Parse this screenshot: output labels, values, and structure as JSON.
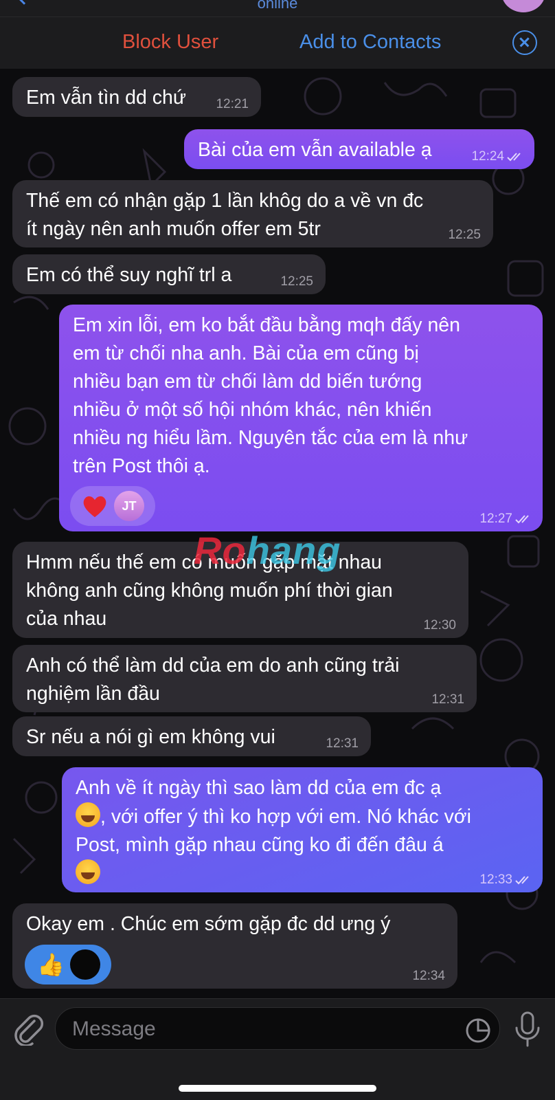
{
  "header": {
    "status": "online",
    "block_label": "Block User",
    "add_label": "Add to Contacts"
  },
  "messages": [
    {
      "dir": "in",
      "text": "Em vẫn tìn dd chứ",
      "time": "12:21"
    },
    {
      "dir": "out",
      "text": "Bài của em vẫn available ạ",
      "time": "12:24"
    },
    {
      "dir": "in",
      "lines": [
        "Thế em có nhận gặp 1 lần khôg do a về vn đc",
        "ít ngày nên anh muốn offer em 5tr"
      ],
      "time": "12:25"
    },
    {
      "dir": "in",
      "text": "Em có thể suy nghĩ trl a",
      "time": "12:25"
    },
    {
      "dir": "out",
      "lines": [
        "Em xin lỗi, em ko bắt đầu bằng mqh đấy nên",
        "em từ chối nha anh. Bài của em cũng bị",
        "nhiều bạn em từ chối làm dd biến tướng",
        "nhiều ở một số hội nhóm khác, nên khiến",
        "nhiều ng hiểu lầm. Nguyên tắc của em là như",
        "trên Post thôi ạ."
      ],
      "time": "12:27",
      "reaction": {
        "emoji": "heart",
        "avatar": "JT"
      }
    },
    {
      "dir": "in",
      "lines": [
        "Hmm nếu thế em có muốn gặp mặt nhau",
        "không anh cũng không muốn phí thời gian",
        "của nhau"
      ],
      "time": "12:30"
    },
    {
      "dir": "in",
      "lines": [
        "Anh có thể làm dd của em do anh cũng trải",
        "nghiệm lần đầu"
      ],
      "time": "12:31"
    },
    {
      "dir": "in",
      "text": "Sr nếu a nói gì em không vui",
      "time": "12:31"
    },
    {
      "dir": "out",
      "lines": [
        "Anh về ít ngày thì sao làm dd của em đc ạ",
        ", với offer ý thì ko hợp với em. Nó khác với",
        "Post, mình gặp nhau cũng ko đi đến đâu á"
      ],
      "time": "12:33"
    },
    {
      "dir": "in",
      "text": "Okay em . Chúc em sớm gặp đc dd ưng ý",
      "time": "12:34",
      "reaction": {
        "emoji": "thumbs-up"
      }
    }
  ],
  "watermark": {
    "part1": "Ro",
    "part2": "hang"
  },
  "composer": {
    "placeholder": "Message"
  },
  "colors": {
    "accent": "#4a8fe8",
    "block": "#e0503d",
    "outgoing": "#8e52ec",
    "incoming": "#2d2b31"
  }
}
